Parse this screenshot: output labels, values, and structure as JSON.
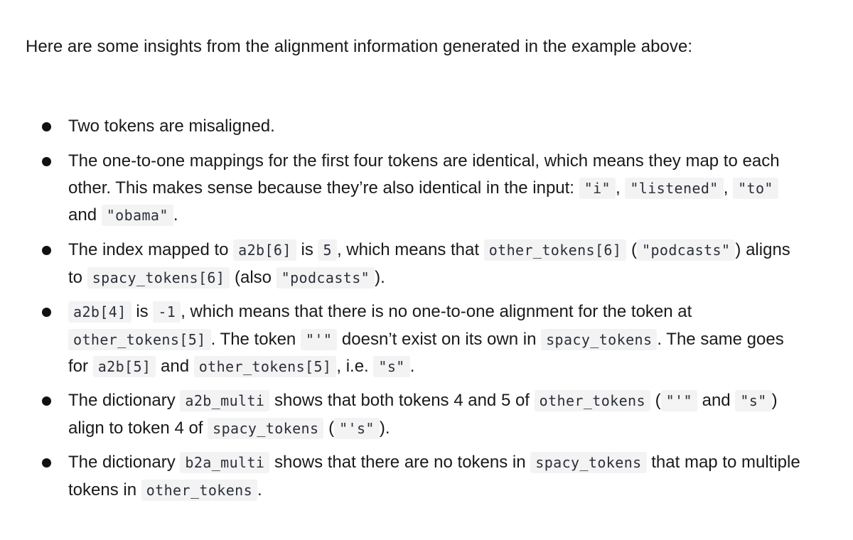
{
  "intro": "Here are some insights from the alignment information generated in the example above:",
  "bullets": [
    {
      "t1": "Two tokens are misaligned."
    },
    {
      "t1": "The one-to-one mappings for the first four tokens are identical, which means they map to each other. This makes sense because they’re also identical in the input: ",
      "c1": "\"i\"",
      "t2": ", ",
      "c2": "\"listened\"",
      "t3": ", ",
      "c3": "\"to\"",
      "t4": " and ",
      "c4": "\"obama\"",
      "t5": "."
    },
    {
      "t1": "The index mapped to ",
      "c1": "a2b[6]",
      "t2": " is ",
      "c2": "5",
      "t3": ", which means that ",
      "c3": "other_tokens[6]",
      "t4": " (",
      "c4": "\"podcasts\"",
      "t5": ") aligns to ",
      "c5": "spacy_tokens[6]",
      "t6": " (also ",
      "c6": "\"podcasts\"",
      "t7": ")."
    },
    {
      "c1": "a2b[4]",
      "t1": " is ",
      "c2": "-1",
      "t2": ", which means that there is no one-to-one alignment for the token at ",
      "c3": "other_tokens[5]",
      "t3": ". The token ",
      "c4": "\"'\"",
      "t4": " doesn’t exist on its own in ",
      "c5": "spacy_tokens",
      "t5": ". The same goes for ",
      "c6": "a2b[5]",
      "t6": " and ",
      "c7": "other_tokens[5]",
      "t7": ", i.e. ",
      "c8": "\"s\"",
      "t8": "."
    },
    {
      "t1": "The dictionary ",
      "c1": "a2b_multi",
      "t2": " shows that both tokens 4 and 5 of ",
      "c2": "other_tokens",
      "t3": " (",
      "c3": "\"'\"",
      "t4": " and ",
      "c4": "\"s\"",
      "t5": ") align to token 4 of ",
      "c5": "spacy_tokens",
      "t6": " (",
      "c6": "\"'s\"",
      "t7": ")."
    },
    {
      "t1": "The dictionary ",
      "c1": "b2a_multi",
      "t2": " shows that there are no tokens in ",
      "c2": "spacy_tokens",
      "t3": " that map to multiple tokens in ",
      "c3": "other_tokens",
      "t4": "."
    }
  ]
}
